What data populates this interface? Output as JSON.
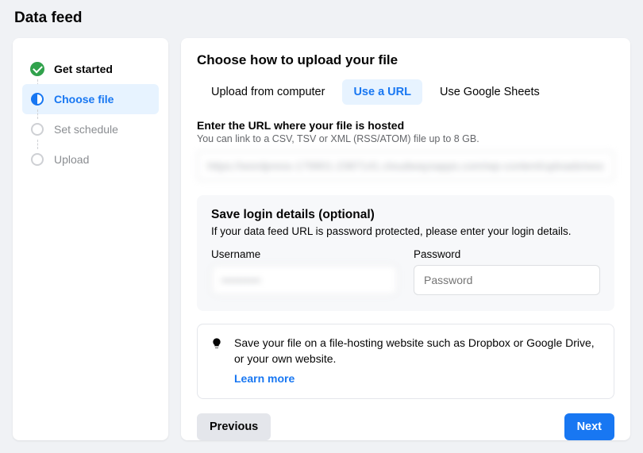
{
  "page_title": "Data feed",
  "steps": [
    {
      "label": "Get started",
      "state": "done"
    },
    {
      "label": "Choose file",
      "state": "active"
    },
    {
      "label": "Set schedule",
      "state": "pending"
    },
    {
      "label": "Upload",
      "state": "pending"
    }
  ],
  "main": {
    "heading": "Choose how to upload your file",
    "tabs": [
      {
        "label": "Upload from computer",
        "active": false
      },
      {
        "label": "Use a URL",
        "active": true
      },
      {
        "label": "Use Google Sheets",
        "active": false
      }
    ],
    "url_section": {
      "label": "Enter the URL where your file is hosted",
      "help": "You can link to a CSV, TSV or XML (RSS/ATOM) file up to 8 GB.",
      "value": "https://wordpress-179901-2387141.cloudwaysapps.com/wp-content/uploads/woof..."
    },
    "login": {
      "heading": "Save login details (optional)",
      "sub": "If your data feed URL is password protected, please enter your login details.",
      "username_label": "Username",
      "username_value": "••••••••••",
      "password_label": "Password",
      "password_placeholder": "Password"
    },
    "tip": {
      "text": "Save your file on a file-hosting website such as Dropbox or Google Drive, or your own website.",
      "link": "Learn more"
    },
    "buttons": {
      "previous": "Previous",
      "next": "Next"
    }
  }
}
